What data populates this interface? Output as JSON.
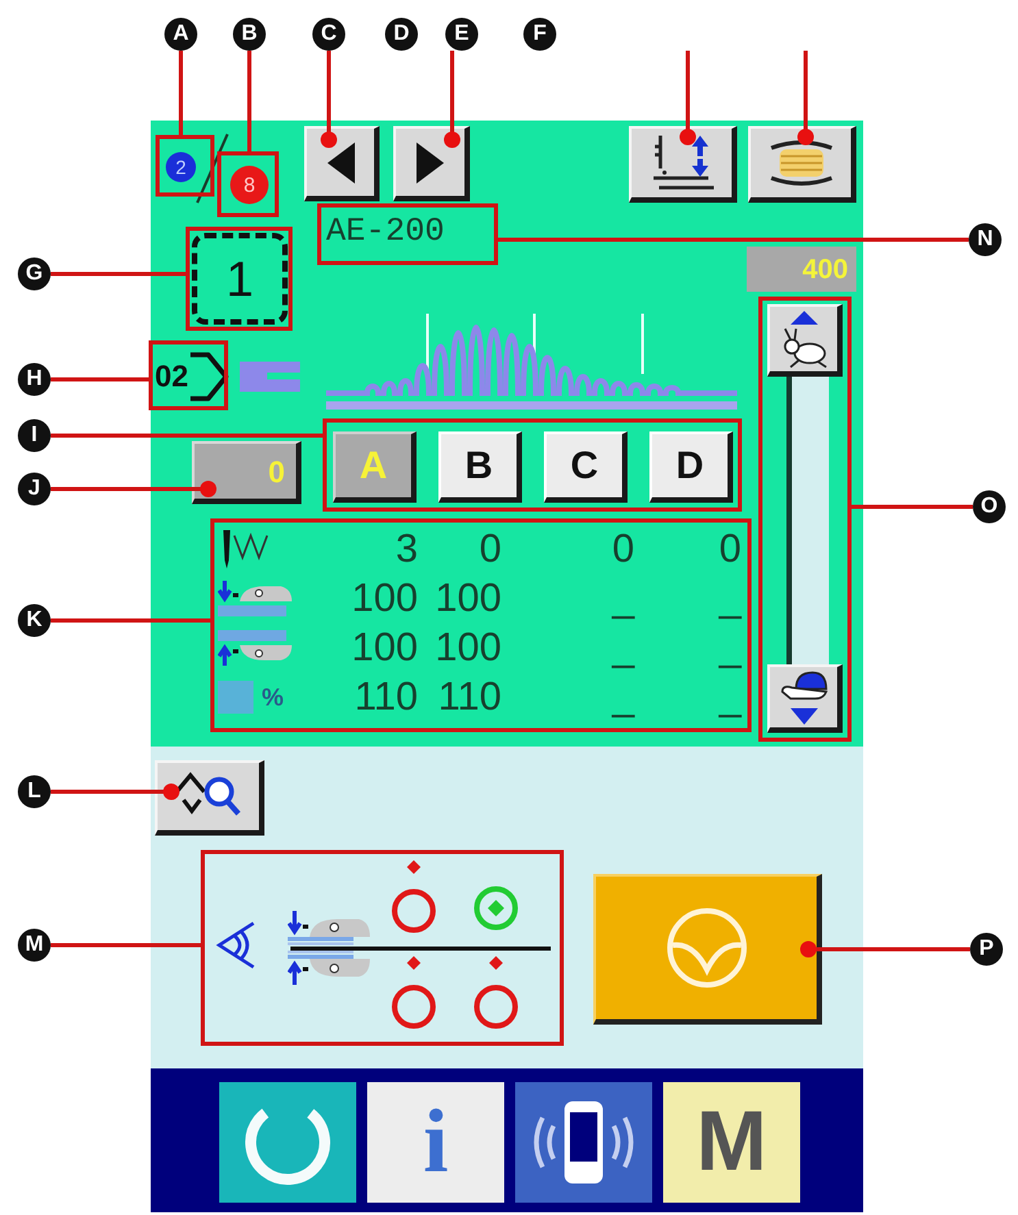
{
  "callouts": [
    {
      "letter": "A"
    },
    {
      "letter": "B"
    },
    {
      "letter": "C"
    },
    {
      "letter": "D"
    },
    {
      "letter": "E"
    },
    {
      "letter": "F"
    },
    {
      "letter": "G"
    },
    {
      "letter": "H"
    },
    {
      "letter": "N"
    },
    {
      "letter": "I"
    },
    {
      "letter": "J"
    },
    {
      "letter": "K"
    },
    {
      "letter": "O"
    },
    {
      "letter": "L"
    },
    {
      "letter": "M"
    },
    {
      "letter": "P"
    }
  ],
  "panel": {
    "pattern_counter": {
      "current": "2",
      "total": "8"
    },
    "pattern_name": "AE-200",
    "speed": "400",
    "cycle_number": "1",
    "step_number": "02",
    "count_value": "0",
    "steps": [
      {
        "label": "A",
        "selected": true
      },
      {
        "label": "B",
        "selected": false
      },
      {
        "label": "C",
        "selected": false
      },
      {
        "label": "D",
        "selected": false
      }
    ],
    "parameters": [
      {
        "kind": "needle",
        "values": [
          "3",
          "0",
          "0",
          "0"
        ]
      },
      {
        "kind": "lower_foot",
        "values": [
          "100",
          "100",
          "_",
          "_"
        ]
      },
      {
        "kind": "upper_foot",
        "values": [
          "100",
          "100",
          "_",
          "_"
        ]
      },
      {
        "kind": "percent",
        "unit": "%",
        "values": [
          "110",
          "110",
          "_",
          "_"
        ]
      }
    ],
    "thread_indicators": [
      {
        "active": false
      },
      {
        "active": true
      },
      {
        "active": false
      },
      {
        "active": false
      }
    ],
    "menu_bar": [
      {
        "kind": "reset"
      },
      {
        "kind": "info",
        "label": "i"
      },
      {
        "kind": "communication"
      },
      {
        "kind": "mode",
        "label": "M"
      }
    ]
  }
}
